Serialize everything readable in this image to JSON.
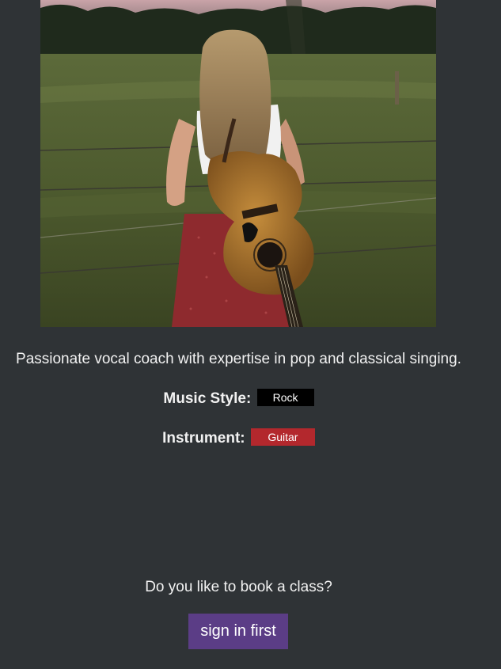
{
  "profile": {
    "photo_icon": "guitarist-photo",
    "bio": "Passionate vocal coach with expertise in pop and classical singing.",
    "music_style_label": "Music Style:",
    "music_style_value": "Rock",
    "instrument_label": "Instrument:",
    "instrument_value": "Guitar"
  },
  "booking": {
    "prompt": "Do you like to book a class?",
    "button_label": "sign in first"
  },
  "colors": {
    "background": "#2f3336",
    "rock_tag": "#000000",
    "guitar_tag": "#b3282d",
    "button": "#5b3d86"
  }
}
